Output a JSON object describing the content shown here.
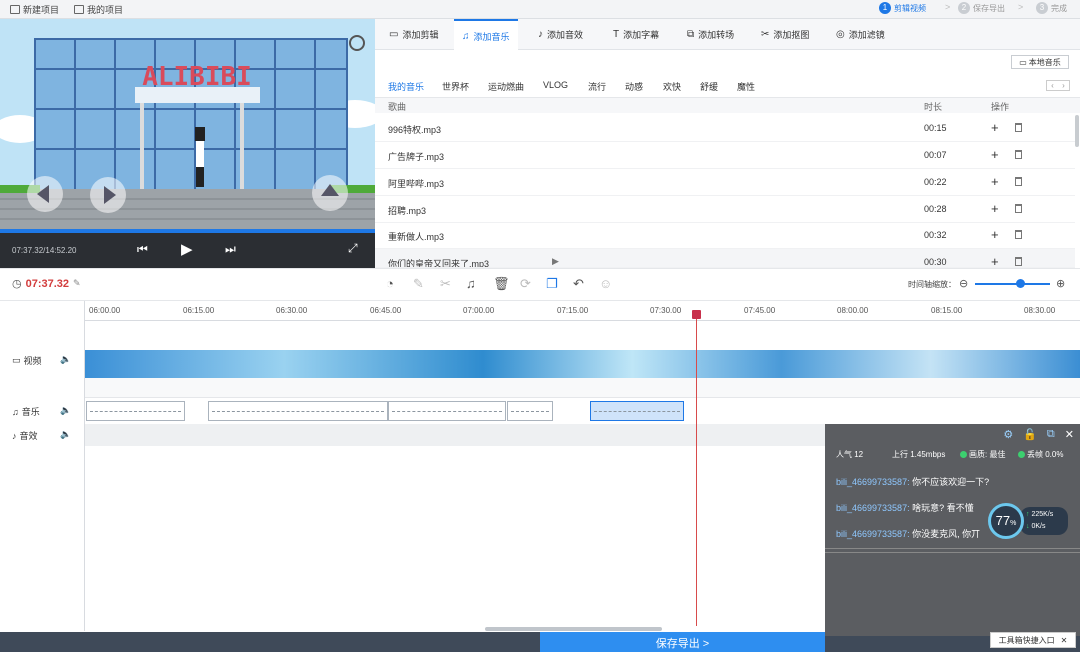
{
  "topbar": {
    "new_project": "新建项目",
    "my_projects": "我的项目",
    "steps": [
      {
        "num": "1",
        "label": "剪辑视频"
      },
      {
        "num": "2",
        "label": "保存导出"
      },
      {
        "num": "3",
        "label": "完成"
      }
    ],
    "sep": ">"
  },
  "preview": {
    "sign_text": "ALIBIBI",
    "time_display": "07:37.32/14:52.20"
  },
  "tabs": [
    {
      "icon": "video-clip-icon",
      "glyph": "▭",
      "label": "添加剪辑"
    },
    {
      "icon": "music-note-icon",
      "glyph": "♫",
      "label": "添加音乐"
    },
    {
      "icon": "sound-effect-icon",
      "glyph": "♪",
      "label": "添加音效"
    },
    {
      "icon": "text-icon",
      "glyph": "T",
      "label": "添加字幕"
    },
    {
      "icon": "transition-icon",
      "glyph": "⧉",
      "label": "添加转场"
    },
    {
      "icon": "cutout-icon",
      "glyph": "✂",
      "label": "添加抠图"
    },
    {
      "icon": "filter-icon",
      "glyph": "◎",
      "label": "添加滤镜"
    }
  ],
  "local_music_label": "本地音乐",
  "categories": [
    "我的音乐",
    "世界杯",
    "运动燃曲",
    "VLOG",
    "流行",
    "动感",
    "欢快",
    "舒缓",
    "魔性"
  ],
  "table": {
    "col_song": "歌曲",
    "col_duration": "时长",
    "col_action": "操作",
    "add_glyph": "+",
    "rows": [
      {
        "name": "996特权.mp3",
        "duration": "00:15"
      },
      {
        "name": "广告牌子.mp3",
        "duration": "00:07"
      },
      {
        "name": "阿里哔哔.mp3",
        "duration": "00:22"
      },
      {
        "name": "招聘.mp3",
        "duration": "00:28"
      },
      {
        "name": "重新做人.mp3",
        "duration": "00:32"
      },
      {
        "name": "你们的皇帝又回来了.mp3",
        "duration": "00:30"
      }
    ]
  },
  "timeline": {
    "current_time": "07:37.32",
    "zoom_label": "时间轴缩放：",
    "ticks": [
      "06:00.00",
      "06:15.00",
      "06:30.00",
      "06:45.00",
      "07:00.00",
      "07:15.00",
      "07:30.00",
      "07:45.00",
      "08:00.00",
      "08:15.00",
      "08:30.00"
    ],
    "zoom_level": 0.55,
    "tracks": {
      "video": "视频",
      "music": "音乐",
      "effect": "音效"
    }
  },
  "export_label": "保存导出 >",
  "overlay": {
    "popularity": "人气  12",
    "upload": "上行  1.45mbps",
    "quality": "画质: 最佳",
    "frame_drop": "丢帧 0.0%",
    "messages": [
      {
        "user": "bili_46699733587:",
        "text": " 你不应该欢迎一下?"
      },
      {
        "user": "bili_46699733587:",
        "text": " 啥玩意? 看不懂"
      },
      {
        "user": "bili_46699733587:",
        "text": " 你没麦克风, 你丌"
      }
    ],
    "gauge": "77",
    "gauge_unit": "%",
    "speed_up": "225",
    "speed_down": "0",
    "speed_unit": "K/s",
    "toolbox": "工具箱快捷入口"
  }
}
